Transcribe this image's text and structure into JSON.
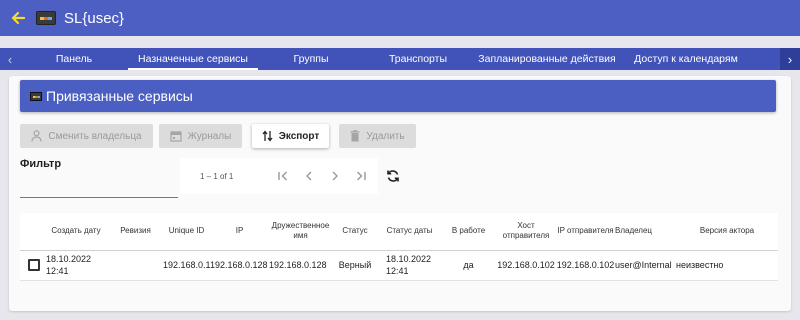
{
  "app": {
    "title": "SL{usec}"
  },
  "tabs": [
    {
      "label": "Панель"
    },
    {
      "label": "Назначенные сервисы",
      "active": true
    },
    {
      "label": "Группы"
    },
    {
      "label": "Транспорты"
    },
    {
      "label": "Запланированные действия"
    },
    {
      "label": "Доступ к календарям"
    }
  ],
  "card": {
    "title": "Привязанные сервисы"
  },
  "toolbar": {
    "change_owner": "Сменить владельца",
    "logs": "Журналы",
    "export": "Экспорт",
    "delete": "Удалить"
  },
  "filter": {
    "label": "Фильтр",
    "value": "",
    "placeholder": ""
  },
  "paginator": {
    "range": "1 – 1 of 1"
  },
  "table": {
    "headers": {
      "created": "Создать дату",
      "revision": "Ревизия",
      "unique_id": "Unique ID",
      "ip": "IP",
      "friendly_name": "Дружественное имя",
      "status": "Статус",
      "status_date": "Статус даты",
      "in_use": "В работе",
      "src_host": "Хост отправителя",
      "src_ip": "IP отправителя",
      "owner": "Владелец",
      "actor_version": "Версия актора"
    },
    "rows": [
      {
        "created": "18.10.2022 12:41",
        "revision": "",
        "unique_id": "192.168.0.128",
        "ip": "192.168.0.128",
        "friendly_name": "192.168.0.128",
        "status": "Верный",
        "status_date": "18.10.2022 12:41",
        "in_use": "да",
        "src_host": "192.168.0.102",
        "src_ip": "192.168.0.102",
        "owner": "user@Internal",
        "actor_version": "неизвестно"
      }
    ]
  },
  "colors": {
    "appbar": "#4d5fc3",
    "tabs": "#4152b8",
    "card_header": "#4a5fc1",
    "back_arrow": "#f2dc2e"
  }
}
